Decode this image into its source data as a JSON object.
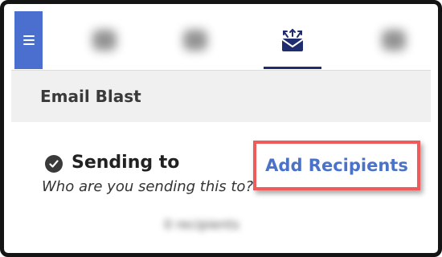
{
  "nav": {
    "menu_icon": "hamburger-icon",
    "tabs": [
      {
        "icon": "blurred-tab-icon"
      },
      {
        "icon": "blurred-tab-icon"
      },
      {
        "icon": "email-blast-envelope-icon",
        "active": true
      },
      {
        "icon": "blurred-tab-icon"
      }
    ],
    "accent_color": "#4a6fcf",
    "active_underline_color": "#1f2d6e"
  },
  "section": {
    "title": "Email Blast"
  },
  "sending": {
    "status_icon": "check-circle-icon",
    "label": "Sending to",
    "subtitle": "Who are you sending this to?",
    "recipients_count": "0 recipients",
    "add_button_label": "Add Recipients",
    "highlight_color": "#ef5b5b",
    "link_color": "#4a72c8"
  }
}
